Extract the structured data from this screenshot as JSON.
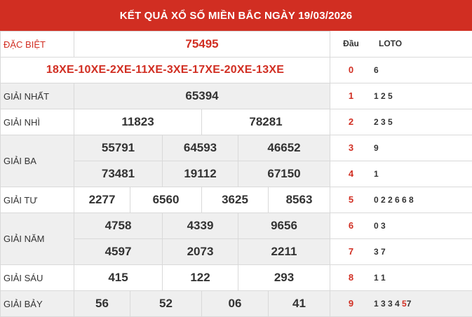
{
  "title": "KẾT QUẢ XỔ SỐ MIỀN BẮC NGÀY 19/03/2026",
  "special": {
    "label": "ĐẶC BIỆT",
    "value": "75495",
    "codes": "18XE-10XE-2XE-11XE-3XE-17XE-20XE-13XE"
  },
  "prizes": {
    "first": {
      "label": "GIẢI NHẤT",
      "values": [
        "65394"
      ]
    },
    "second": {
      "label": "GIẢI NHÌ",
      "values": [
        "11823",
        "78281"
      ]
    },
    "third": {
      "label": "GIẢI BA",
      "values": [
        "55791",
        "64593",
        "46652",
        "73481",
        "19112",
        "67150"
      ]
    },
    "fourth": {
      "label": "GIẢI TƯ",
      "values": [
        "2277",
        "6560",
        "3625",
        "8563"
      ]
    },
    "fifth": {
      "label": "GIẢI NĂM",
      "values": [
        "4758",
        "4339",
        "9656",
        "4597",
        "2073",
        "2211"
      ]
    },
    "sixth": {
      "label": "GIẢI SÁU",
      "values": [
        "415",
        "122",
        "293"
      ]
    },
    "seventh": {
      "label": "GIẢI BẢY",
      "values": [
        "56",
        "52",
        "06",
        "41"
      ]
    }
  },
  "loto": {
    "head_label": "Đầu",
    "loto_label": "LOTO",
    "rows": [
      {
        "dau": "0",
        "loto": "6"
      },
      {
        "dau": "1",
        "loto": "1 2 5"
      },
      {
        "dau": "2",
        "loto": "2 3 5"
      },
      {
        "dau": "3",
        "loto": "9"
      },
      {
        "dau": "4",
        "loto": "1"
      },
      {
        "dau": "5",
        "loto": "0 2 2 6 6 8"
      },
      {
        "dau": "6",
        "loto": "0 3"
      },
      {
        "dau": "7",
        "loto": "3 7"
      },
      {
        "dau": "8",
        "loto": "1 1"
      },
      {
        "dau": "9",
        "loto_pre": "1 3 3 4",
        "loto_hl": "5",
        "loto_post": "7"
      }
    ]
  },
  "colors": {
    "header_bg": "#d12e22",
    "accent": "#d12e22",
    "shade": "#efefef"
  }
}
